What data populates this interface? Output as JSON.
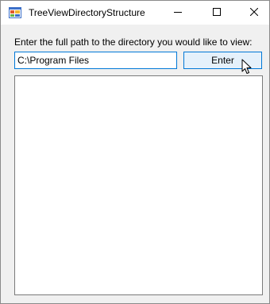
{
  "window": {
    "title": "TreeViewDirectoryStructure",
    "icon": "windows-forms-app-icon",
    "controls": {
      "minimize": "minimize-icon",
      "maximize": "maximize-icon",
      "close": "close-icon"
    }
  },
  "form": {
    "prompt_label": "Enter the full path to the directory you would like to view:",
    "path_value": "C:\\Program Files",
    "enter_label": "Enter"
  },
  "tree_view": {
    "nodes": []
  },
  "colors": {
    "accent": "#0078d7",
    "button_hover": "#e5f1fb",
    "form_background": "#f0f0f0"
  }
}
